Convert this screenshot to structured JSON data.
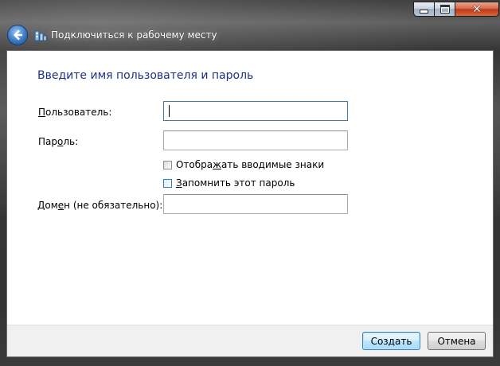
{
  "window": {
    "title": "Подключиться к рабочему месту",
    "caption_buttons": {
      "minimize": "minimize",
      "maximize": "maximize",
      "close": "✕"
    }
  },
  "form": {
    "heading": "Введите имя пользователя и пароль",
    "username": {
      "label_underlined": "П",
      "label_rest": "ользователь:",
      "value": ""
    },
    "password": {
      "label_before": "Пар",
      "label_underlined": "о",
      "label_after": "ль:",
      "value": ""
    },
    "show_chars": {
      "label_before": "Отобра",
      "label_underlined": "ж",
      "label_after": "ать вводимые знаки",
      "checked": false
    },
    "remember": {
      "label_underlined": "З",
      "label_rest": "апомнить этот пароль",
      "checked": false
    },
    "domain": {
      "label_before": "Дом",
      "label_underlined": "е",
      "label_after": "н (не обязательно):",
      "value": ""
    }
  },
  "footer": {
    "create_label": "Создать",
    "cancel_label": "Отмена"
  },
  "icons": {
    "back": "back-arrow-icon",
    "app": "workplace-network-icon"
  }
}
